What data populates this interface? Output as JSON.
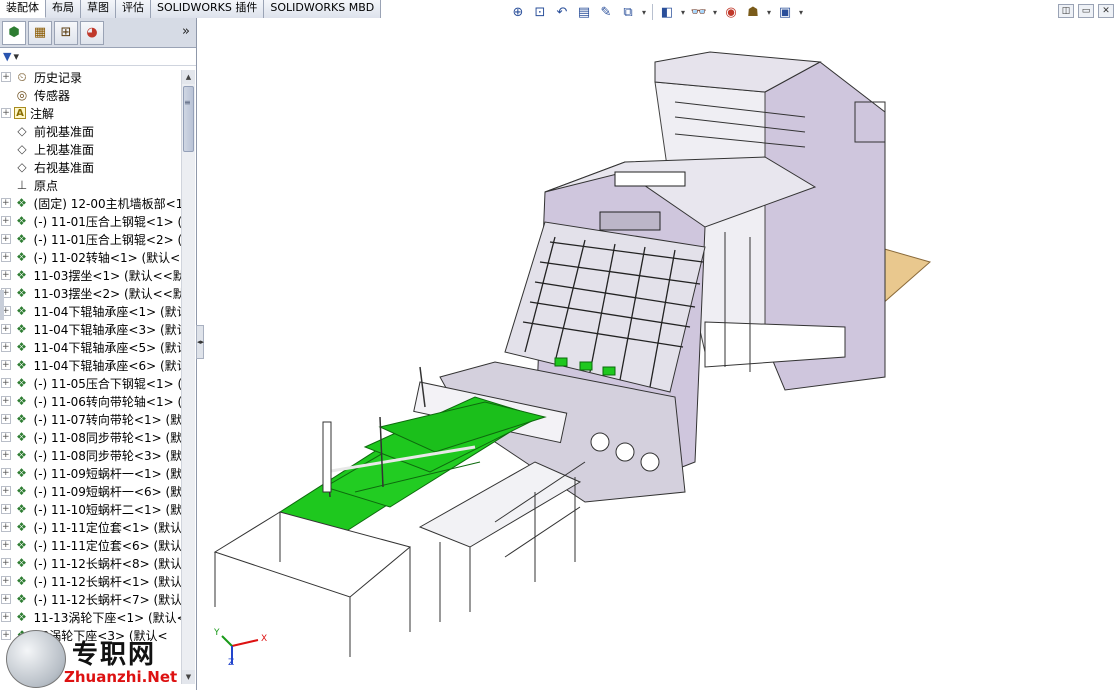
{
  "tabs": [
    {
      "label": "装配体",
      "active": true
    },
    {
      "label": "布局",
      "active": false
    },
    {
      "label": "草图",
      "active": false
    },
    {
      "label": "评估",
      "active": false
    },
    {
      "label": "SOLIDWORKS 插件",
      "active": false
    },
    {
      "label": "SOLIDWORKS MBD",
      "active": false
    }
  ],
  "hud_icons": [
    "zoom-to-fit-icon",
    "zoom-area-icon",
    "previous-view-icon",
    "section-view-icon",
    "dynamic-annotation-icon",
    "view-orientation-icon",
    "display-style-icon",
    "hide-show-icon",
    "edit-appearance-icon",
    "apply-scene-icon",
    "view-settings-icon"
  ],
  "panel": {
    "more_glyph": "»",
    "filter_glyph": "▾"
  },
  "tree": [
    {
      "label": "历史记录",
      "icon": "history",
      "expand": "+"
    },
    {
      "label": "传感器",
      "icon": "sensor",
      "expand": ""
    },
    {
      "label": "注解",
      "icon": "annotation",
      "expand": "+"
    },
    {
      "label": "前视基准面",
      "icon": "plane",
      "expand": ""
    },
    {
      "label": "上视基准面",
      "icon": "plane",
      "expand": ""
    },
    {
      "label": "右视基准面",
      "icon": "plane",
      "expand": ""
    },
    {
      "label": "原点",
      "icon": "origin",
      "expand": ""
    },
    {
      "label": "(固定) 12-00主机墙板部<1",
      "icon": "part",
      "expand": "+"
    },
    {
      "label": "(-) 11-01压合上钢辊<1> (",
      "icon": "part",
      "expand": "+"
    },
    {
      "label": "(-) 11-01压合上钢辊<2> (",
      "icon": "part",
      "expand": "+"
    },
    {
      "label": "(-) 11-02转轴<1> (默认<<",
      "icon": "part",
      "expand": "+"
    },
    {
      "label": "11-03摆坐<1> (默认<<默",
      "icon": "part",
      "expand": "+"
    },
    {
      "label": "11-03摆坐<2> (默认<<默",
      "icon": "part",
      "expand": "+"
    },
    {
      "label": "11-04下辊轴承座<1> (默认",
      "icon": "part",
      "expand": "+"
    },
    {
      "label": "11-04下辊轴承座<3> (默认",
      "icon": "part",
      "expand": "+"
    },
    {
      "label": "11-04下辊轴承座<5> (默认",
      "icon": "part",
      "expand": "+"
    },
    {
      "label": "11-04下辊轴承座<6> (默认",
      "icon": "part",
      "expand": "+"
    },
    {
      "label": "(-) 11-05压合下钢辊<1> (",
      "icon": "part",
      "expand": "+"
    },
    {
      "label": "(-) 11-06转向带轮轴<1> (",
      "icon": "part",
      "expand": "+"
    },
    {
      "label": "(-) 11-07转向带轮<1> (默",
      "icon": "part",
      "expand": "+"
    },
    {
      "label": "(-) 11-08同步带轮<1> (默",
      "icon": "part",
      "expand": "+"
    },
    {
      "label": "(-) 11-08同步带轮<3> (默",
      "icon": "part",
      "expand": "+"
    },
    {
      "label": "(-) 11-09短蜗杆一<1> (默",
      "icon": "part",
      "expand": "+"
    },
    {
      "label": "(-) 11-09短蜗杆一<6> (默",
      "icon": "part",
      "expand": "+"
    },
    {
      "label": "(-) 11-10短蜗杆二<1> (默",
      "icon": "part",
      "expand": "+"
    },
    {
      "label": "(-) 11-11定位套<1> (默认",
      "icon": "part",
      "expand": "+"
    },
    {
      "label": "(-) 11-11定位套<6> (默认",
      "icon": "part",
      "expand": "+"
    },
    {
      "label": "(-) 11-12长蜗杆<8> (默认",
      "icon": "part",
      "expand": "+"
    },
    {
      "label": "(-) 11-12长蜗杆<1> (默认",
      "icon": "part",
      "expand": "+"
    },
    {
      "label": "(-) 11-12长蜗杆<7> (默认",
      "icon": "part",
      "expand": "+"
    },
    {
      "label": "11-13涡轮下座<1> (默认<",
      "icon": "part",
      "expand": "+"
    },
    {
      "label": "13涡轮下座<3> (默认<",
      "icon": "part",
      "expand": "+"
    }
  ],
  "triad": {
    "x": "X",
    "y": "Y",
    "z": "Z"
  },
  "watermark": {
    "cn": "专职网",
    "en": "Zhuanzhi.Net"
  },
  "colors": {
    "belt_green": "#1ec81e",
    "frame_lilac": "#cfc6dd",
    "board_tan": "#e9c88e"
  }
}
